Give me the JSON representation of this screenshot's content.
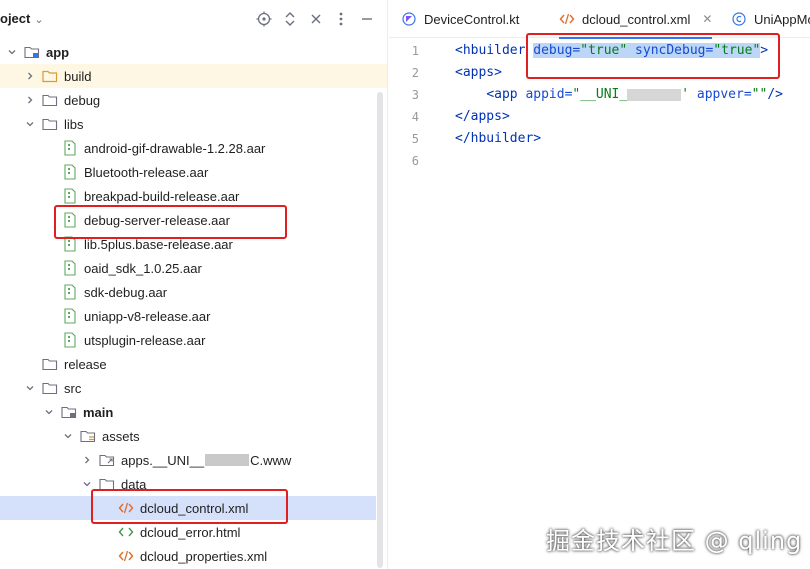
{
  "project_panel": {
    "title": "oject",
    "header_icons": [
      "target-icon",
      "expand-collapse-icon",
      "close-all-icon",
      "more-options-icon",
      "minimize-icon"
    ],
    "tree": [
      {
        "label": "app",
        "kind": "module-folder",
        "expanded": true,
        "bold": true
      },
      {
        "label": "build",
        "kind": "folder-orange",
        "expanded": false
      },
      {
        "label": "debug",
        "kind": "folder",
        "expanded": false
      },
      {
        "label": "libs",
        "kind": "folder",
        "expanded": true
      },
      {
        "label": "android-gif-drawable-1.2.28.aar",
        "kind": "aar"
      },
      {
        "label": "Bluetooth-release.aar",
        "kind": "aar"
      },
      {
        "label": "breakpad-build-release.aar",
        "kind": "aar"
      },
      {
        "label": "debug-server-release.aar",
        "kind": "aar"
      },
      {
        "label": "lib.5plus.base-release.aar",
        "kind": "aar"
      },
      {
        "label": "oaid_sdk_1.0.25.aar",
        "kind": "aar"
      },
      {
        "label": "sdk-debug.aar",
        "kind": "aar"
      },
      {
        "label": "uniapp-v8-release.aar",
        "kind": "aar"
      },
      {
        "label": "utsplugin-release.aar",
        "kind": "aar"
      },
      {
        "label": "release",
        "kind": "folder"
      },
      {
        "label": "src",
        "kind": "folder",
        "expanded": true
      },
      {
        "label": "main",
        "kind": "source-folder",
        "expanded": true,
        "bold": true
      },
      {
        "label": "assets",
        "kind": "resources-folder",
        "expanded": true
      },
      {
        "label_prefix": "apps.__UNI__",
        "label_suffix": "C.www",
        "kind": "folder-link",
        "expanded": false
      },
      {
        "label": "data",
        "kind": "folder",
        "expanded": true
      },
      {
        "label": "dcloud_control.xml",
        "kind": "xml-file",
        "selected": true
      },
      {
        "label": "dcloud_error.html",
        "kind": "html-file"
      },
      {
        "label": "dcloud_properties.xml",
        "kind": "xml-file"
      }
    ]
  },
  "editor": {
    "tabs": [
      {
        "label": "DeviceControl.kt",
        "icon": "kotlin-file-icon"
      },
      {
        "label": "dcloud_control.xml",
        "icon": "xml-file-icon",
        "active": true
      },
      {
        "label": "UniAppMo",
        "icon": "class-icon"
      }
    ],
    "close_glyph": "✕",
    "line_numbers": [
      "1",
      "2",
      "3",
      "4",
      "5",
      "6"
    ],
    "code": {
      "l1_open": "<hbuilder",
      "l1_space": " ",
      "l1_attr1": "debug=",
      "l1_val1": "\"true\"",
      "l1_space2": " ",
      "l1_attr2": "syncDebug=",
      "l1_val2": "\"true\"",
      "l1_close": ">",
      "l2_tag": "<apps>",
      "l3_indent": "    ",
      "l3_open": "<app ",
      "l3_attr1": "appid=",
      "l3_val1a": "\"__UNI_",
      "l3_val1b": "'",
      "l3_space": " ",
      "l3_attr2": "appver=",
      "l3_val2": "\"\"",
      "l3_close": "/>",
      "l4_tag": "</apps>",
      "l5_tag": "</hbuilder>"
    }
  },
  "watermark": "掘金技术社区 @ qling",
  "colors": {
    "accent": "#3574f0",
    "highlight_box": "#e02020",
    "selection": "#d5e1fb",
    "string": "#067d17",
    "tag": "#0033b3"
  }
}
